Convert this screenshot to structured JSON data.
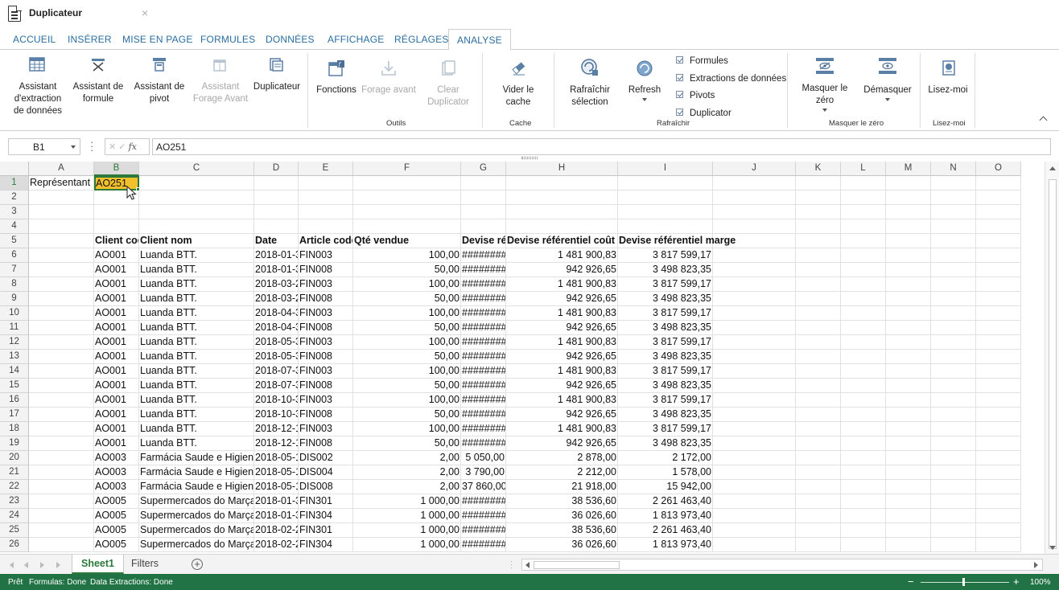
{
  "window": {
    "title": "Duplicateur",
    "close_glyph": "×"
  },
  "ribbon_tabs": [
    "ACCUEIL",
    "INSÉRER",
    "MISE EN PAGE",
    "FORMULES",
    "DONNÉES",
    "AFFICHAGE",
    "RÉGLAGES",
    "ANALYSE"
  ],
  "active_tab": "ANALYSE",
  "ribbon": {
    "buttons": {
      "extraction": "Assistant d'extraction de données",
      "formule": "Assistant de formule",
      "pivot": "Assistant de pivot",
      "forage_avant_assistant": "Assistant Forage Avant",
      "duplicateur": "Duplicateur",
      "fonctions": "Fonctions",
      "forage_avant": "Forage avant",
      "clear_duplicator": "Clear Duplicator",
      "vider_cache": "Vider le cache",
      "rafraichir_selection": "Rafraîchir sélection",
      "refresh": "Refresh",
      "masquer_zero": "Masquer le zéro",
      "demasquer": "Démasquer",
      "lisez_moi": "Lisez-moi"
    },
    "checkboxes": [
      "Formules",
      "Extractions de données",
      "Pivots",
      "Duplicator"
    ],
    "groups": {
      "outils": "Outils",
      "cache": "Cache",
      "rafraichir": "Rafraîchir",
      "masquer": "Masquer le zéro",
      "lisez": "Lisez-moi"
    }
  },
  "formula_bar": {
    "name_box": "B1",
    "fx": "fx",
    "value": "AO251"
  },
  "columns": [
    "A",
    "B",
    "C",
    "D",
    "E",
    "F",
    "G",
    "H",
    "I",
    "J",
    "K",
    "L",
    "M",
    "N",
    "O"
  ],
  "row_numbers": [
    "1",
    "2",
    "3",
    "4",
    "5",
    "6",
    "7",
    "8",
    "9",
    "10",
    "11",
    "12",
    "13",
    "14",
    "15",
    "16",
    "17",
    "18",
    "19",
    "20",
    "21",
    "22",
    "23",
    "24",
    "25",
    "26"
  ],
  "cells": {
    "a1": "Représentant",
    "b1": "AO251",
    "headers": [
      "Client code",
      "Client nom",
      "Date",
      "Article code",
      "Qté vendue",
      "Devise réf",
      "Devise référentiel coût",
      "Devise référentiel marge"
    ]
  },
  "rows": [
    [
      "AO001",
      "Luanda BTT.",
      "2018-01-3",
      "FIN003",
      "100,00",
      "########",
      "1 481 900,83",
      "3 817 599,17"
    ],
    [
      "AO001",
      "Luanda BTT.",
      "2018-01-3",
      "FIN008",
      "50,00",
      "########",
      "942 926,65",
      "3 498 823,35"
    ],
    [
      "AO001",
      "Luanda BTT.",
      "2018-03-2",
      "FIN003",
      "100,00",
      "########",
      "1 481 900,83",
      "3 817 599,17"
    ],
    [
      "AO001",
      "Luanda BTT.",
      "2018-03-2",
      "FIN008",
      "50,00",
      "########",
      "942 926,65",
      "3 498 823,35"
    ],
    [
      "AO001",
      "Luanda BTT.",
      "2018-04-3",
      "FIN003",
      "100,00",
      "########",
      "1 481 900,83",
      "3 817 599,17"
    ],
    [
      "AO001",
      "Luanda BTT.",
      "2018-04-3",
      "FIN008",
      "50,00",
      "########",
      "942 926,65",
      "3 498 823,35"
    ],
    [
      "AO001",
      "Luanda BTT.",
      "2018-05-3",
      "FIN003",
      "100,00",
      "########",
      "1 481 900,83",
      "3 817 599,17"
    ],
    [
      "AO001",
      "Luanda BTT.",
      "2018-05-3",
      "FIN008",
      "50,00",
      "########",
      "942 926,65",
      "3 498 823,35"
    ],
    [
      "AO001",
      "Luanda BTT.",
      "2018-07-3",
      "FIN003",
      "100,00",
      "########",
      "1 481 900,83",
      "3 817 599,17"
    ],
    [
      "AO001",
      "Luanda BTT.",
      "2018-07-3",
      "FIN008",
      "50,00",
      "########",
      "942 926,65",
      "3 498 823,35"
    ],
    [
      "AO001",
      "Luanda BTT.",
      "2018-10-3",
      "FIN003",
      "100,00",
      "########",
      "1 481 900,83",
      "3 817 599,17"
    ],
    [
      "AO001",
      "Luanda BTT.",
      "2018-10-3",
      "FIN008",
      "50,00",
      "########",
      "942 926,65",
      "3 498 823,35"
    ],
    [
      "AO001",
      "Luanda BTT.",
      "2018-12-1",
      "FIN003",
      "100,00",
      "########",
      "1 481 900,83",
      "3 817 599,17"
    ],
    [
      "AO001",
      "Luanda BTT.",
      "2018-12-1",
      "FIN008",
      "50,00",
      "########",
      "942 926,65",
      "3 498 823,35"
    ],
    [
      "AO003",
      "Farmácia Saude e Higiene",
      "2018-05-1",
      "DIS002",
      "2,00",
      "5 050,00",
      "2 878,00",
      "2 172,00"
    ],
    [
      "AO003",
      "Farmácia Saude e Higiene",
      "2018-05-1",
      "DIS004",
      "2,00",
      "3 790,00",
      "2 212,00",
      "1 578,00"
    ],
    [
      "AO003",
      "Farmácia Saude e Higiene",
      "2018-05-1",
      "DIS008",
      "2,00",
      "37 860,00",
      "21 918,00",
      "15 942,00"
    ],
    [
      "AO005",
      "Supermercados do Marçal",
      "2018-01-3",
      "FIN301",
      "1 000,00",
      "########",
      "38 536,60",
      "2 261 463,40"
    ],
    [
      "AO005",
      "Supermercados do Marçal",
      "2018-01-3",
      "FIN304",
      "1 000,00",
      "########",
      "36 026,60",
      "1 813 973,40"
    ],
    [
      "AO005",
      "Supermercados do Marçal",
      "2018-02-2",
      "FIN301",
      "1 000,00",
      "########",
      "38 536,60",
      "2 261 463,40"
    ],
    [
      "AO005",
      "Supermercados do Marçal",
      "2018-02-2",
      "FIN304",
      "1 000,00",
      "########",
      "36 026,60",
      "1 813 973,40"
    ]
  ],
  "sheets": [
    "Sheet1",
    "Filters"
  ],
  "active_sheet": "Sheet1",
  "status": {
    "ready": "Prêt",
    "formulas": "Formulas: Done",
    "extractions": "Data Extractions: Done",
    "zoom": "100%",
    "zoom_level": 1.0
  },
  "colors": {
    "accent": "#217346",
    "active_cell_fill": "#f2c02d",
    "tab_text": "#2a6ea0"
  },
  "icons": [
    "doc-icon",
    "close-icon",
    "table-icon",
    "formula-wizard-icon",
    "pivot-icon",
    "drill-forward-icon",
    "duplicator-icon",
    "functions-icon",
    "download-icon",
    "clear-icon",
    "eraser-icon",
    "refresh-selection-icon",
    "refresh-icon",
    "hide-zero-icon",
    "show-zero-icon",
    "readme-icon",
    "cursor-icon",
    "add-sheet-icon"
  ]
}
